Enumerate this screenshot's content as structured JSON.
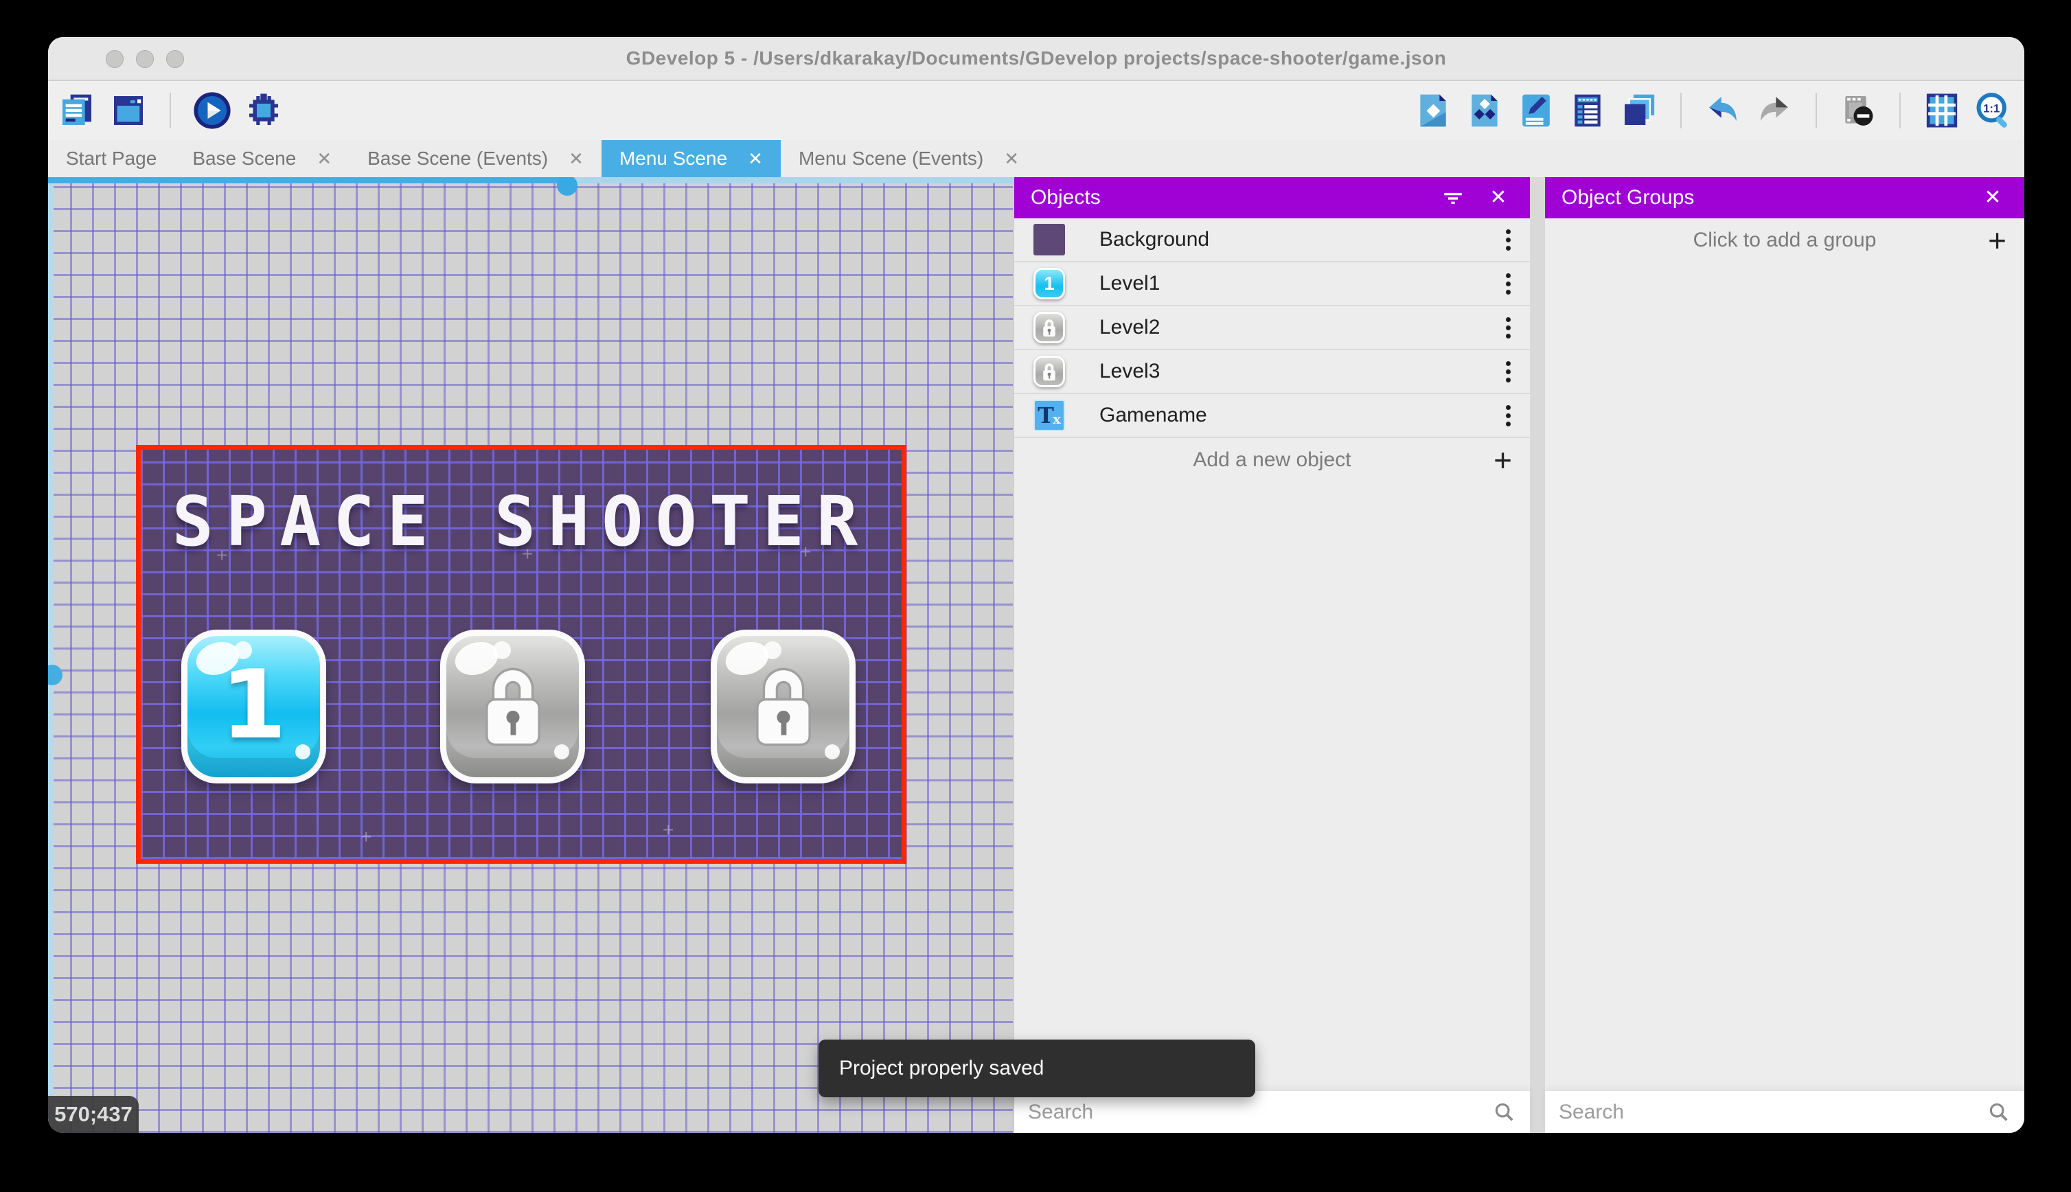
{
  "window": {
    "title": "GDevelop 5 - /Users/dkarakay/Documents/GDevelop projects/space-shooter/game.json"
  },
  "toolbar": {
    "left_icons": [
      "project-manager-icon",
      "scene-editor-icon",
      "play-icon",
      "debug-icon"
    ],
    "right_icons": [
      "objects-panel-icon",
      "object-groups-panel-icon",
      "properties-panel-icon",
      "instances-list-icon",
      "layers-panel-icon",
      "undo-icon",
      "redo-icon",
      "toggle-mask-icon",
      "toggle-grid-icon",
      "zoom-one-to-one-icon"
    ],
    "zoom_label": "1:1"
  },
  "tabs": [
    {
      "label": "Start Page",
      "closable": false,
      "active": false
    },
    {
      "label": "Base Scene",
      "closable": true,
      "active": false
    },
    {
      "label": "Base Scene (Events)",
      "closable": true,
      "active": false
    },
    {
      "label": "Menu Scene",
      "closable": true,
      "active": true
    },
    {
      "label": "Menu Scene (Events)",
      "closable": true,
      "active": false
    }
  ],
  "scene_canvas": {
    "cursor_coordinates": "570;437",
    "game_title": "SPACE SHOOTER",
    "level_buttons": [
      {
        "label": "1",
        "state": "unlocked"
      },
      {
        "label": "",
        "state": "locked"
      },
      {
        "label": "",
        "state": "locked"
      }
    ]
  },
  "objects_panel": {
    "title": "Objects",
    "items": [
      {
        "name": "Background",
        "thumb": "color-swatch"
      },
      {
        "name": "Level1",
        "thumb": "blue-button",
        "thumb_label": "1"
      },
      {
        "name": "Level2",
        "thumb": "locked-button"
      },
      {
        "name": "Level3",
        "thumb": "locked-button"
      },
      {
        "name": "Gamename",
        "thumb": "text-object"
      }
    ],
    "add_button_label": "Add a new object",
    "search_placeholder": "Search"
  },
  "object_groups_panel": {
    "title": "Object Groups",
    "add_button_label": "Click to add a group",
    "search_placeholder": "Search"
  },
  "toast": {
    "message": "Project properly saved"
  },
  "icon_glyphs": {
    "close": "✕",
    "plus": "+",
    "star": "+",
    "text_object_main": "T",
    "text_object_sub": "x"
  },
  "colors": {
    "accent_blue": "#49aee3",
    "panel_header_purple": "#a002d6",
    "scene_background": "#57446d",
    "selection_red": "#fe2700",
    "grid_line": "#675dcd",
    "toast_background": "#2f2f2f"
  }
}
